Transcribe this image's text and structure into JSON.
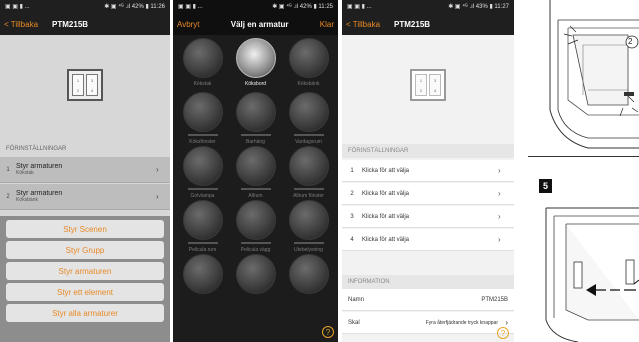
{
  "screen1": {
    "status_left": "▣ ▣ ▮ ...",
    "status_right": "✱ ▣ ⁴ᴳ .ıl 42% ▮ 11:26",
    "back_label": "Tillbaka",
    "title": "PTM215B",
    "section": "FÖRINSTÄLLNINGAR",
    "rows": [
      {
        "num": "1",
        "main": "Styr armaturen",
        "sub": "Kökstak"
      },
      {
        "num": "2",
        "main": "Styr armaturen",
        "sub": "Köksbänk"
      }
    ],
    "sheet_buttons": [
      "Styr Scenen",
      "Styr Grupp",
      "Styr armaturen",
      "Styr ett element",
      "Styr alla armaturer"
    ]
  },
  "screen2": {
    "status_left": "▣ ▣ ▮ ...",
    "status_right": "✱ ▣ ⁴ᴳ .ıl 42% ▮ 11:25",
    "cancel_label": "Avbryt",
    "title": "Välj en armatur",
    "done_label": "Klar",
    "items": [
      "Kökstak",
      "Köksbord",
      "Köksbänk",
      "Köksfönster",
      "Barhäng",
      "Vardagsrum",
      "Golvlampa",
      "Allrum",
      "Allrum fönster",
      "Pelicula rum",
      "Pelicula vägg",
      "Utebelysning"
    ],
    "help": "?"
  },
  "screen3": {
    "status_left": "▣ ▣ ▮ ...",
    "status_right": "✱ ▣ ⁴ᴳ .ıl 43% ▮ 11:27",
    "back_label": "Tillbaka",
    "title": "PTM215B",
    "section": "FÖRINSTÄLLNINGAR",
    "rows": [
      {
        "num": "1",
        "text": "Klicka för att välja"
      },
      {
        "num": "2",
        "text": "Klicka för att välja"
      },
      {
        "num": "3",
        "text": "Klicka för att välja"
      },
      {
        "num": "4",
        "text": "Klicka för att välja"
      }
    ],
    "info_section": "INFORMATION",
    "name_label": "Namn",
    "name_value": "PTM215B",
    "skal_label": "Skal",
    "skal_value": "Fyra återfjädrande tryck knappar",
    "help": "?"
  },
  "switch_keys": [
    "1",
    "3",
    "2",
    "4"
  ],
  "instructions": {
    "callout": "2",
    "step": "5"
  }
}
